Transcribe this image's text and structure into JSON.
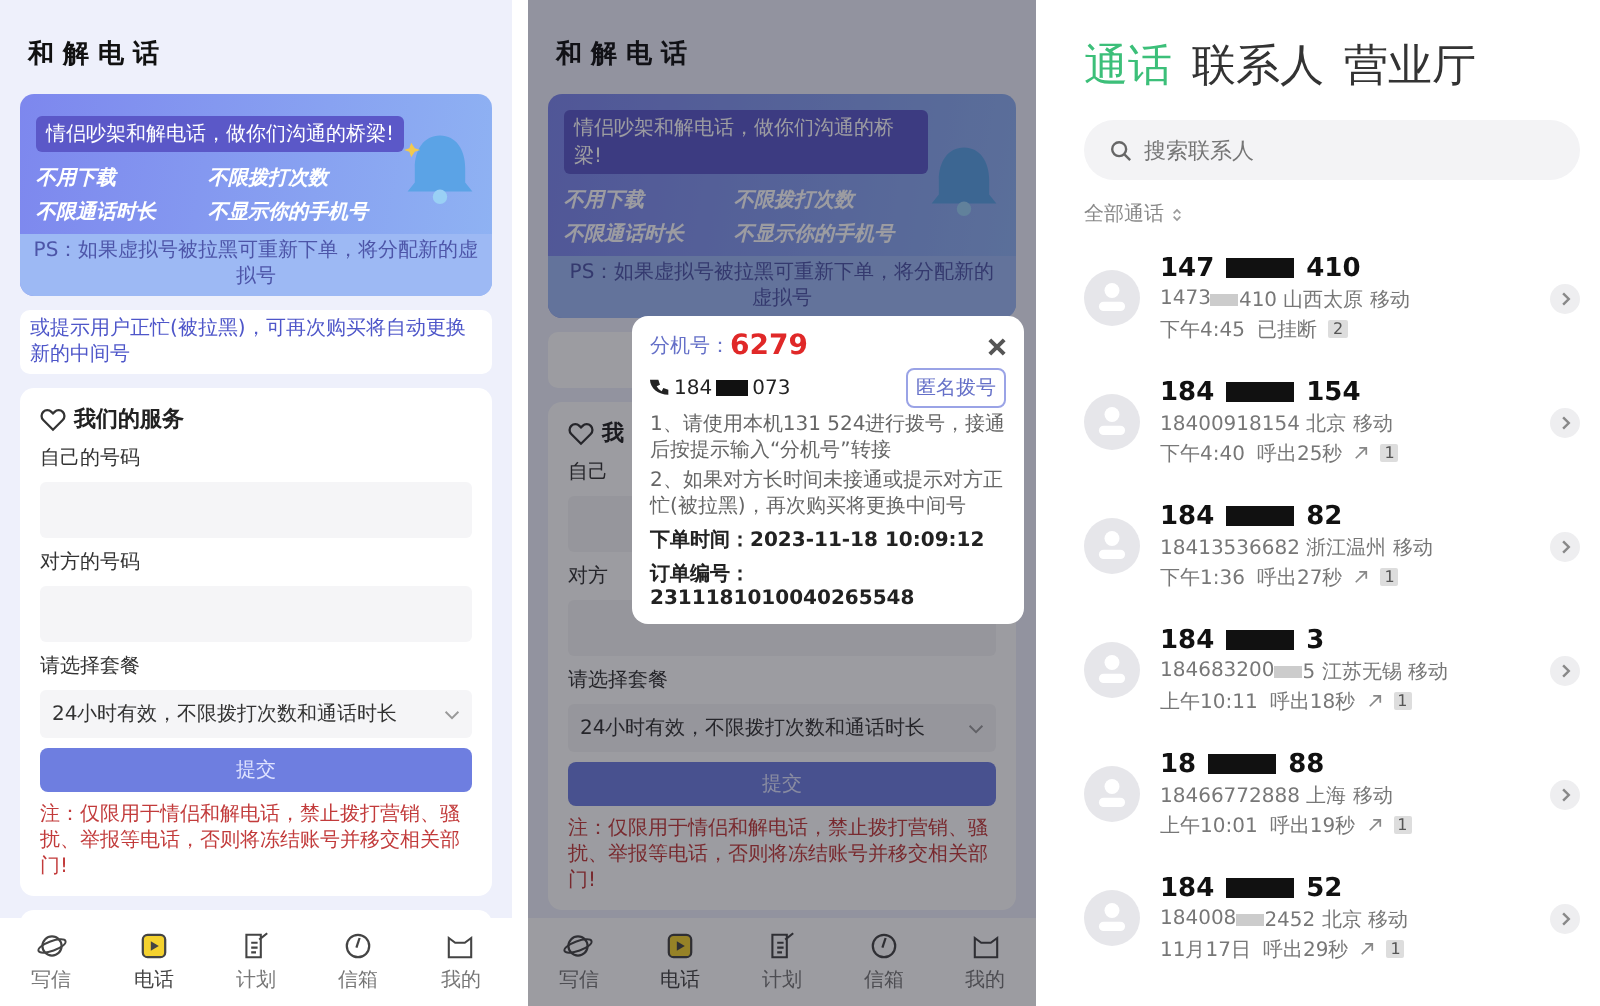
{
  "form_screen": {
    "title": "和 解 电 话",
    "banner": {
      "bubble": "情侣吵架和解电话，做你们沟通的桥梁!",
      "slogans": [
        "不用下载",
        "不限拨打次数",
        "不限通话时长",
        "不显示你的手机号"
      ],
      "ps": "PS：如果虚拟号被拉黑可重新下单，将分配新的虚拟号"
    },
    "notice": "或提示用户正忙(被拉黑)，可再次购买将自动更换新的中间号",
    "service": {
      "heading": "我们的服务",
      "fields": [
        {
          "label": "自己的号码"
        },
        {
          "label": "对方的号码"
        }
      ],
      "plan_label": "请选择套餐",
      "plan_value": "24小时有效，不限拨打次数和通话时长",
      "submit": "提交",
      "note": "注：仅限用于情侣和解电话，禁止拨打营销、骚扰、举报等电话，否则将冻结账号并移交相关部门!"
    },
    "tabs": [
      {
        "label": "写信",
        "selected": false
      },
      {
        "label": "电话",
        "selected": true
      },
      {
        "label": "计划",
        "selected": false
      },
      {
        "label": "信箱",
        "selected": false
      },
      {
        "label": "我的",
        "selected": false
      }
    ]
  },
  "dialog_screen": {
    "backdrop": {
      "title": "和 解 电 话",
      "banner": {
        "bubble": "情侣吵架和解电话，做你们沟通的桥梁!",
        "slogans": [
          "不用下载",
          "不限拨打次数",
          "不限通话时长",
          "不显示你的手机号"
        ],
        "ps": "PS：如果虚拟号被拉黑可重新下单，将分配新的虚拟号"
      },
      "heading_fragment": "我",
      "field_label_fragments": [
        "自己",
        "对方"
      ],
      "plan_label": "请选择套餐",
      "plan_value": "24小时有效，不限拨打次数和通话时长",
      "submit": "提交",
      "note": "注：仅限用于情侣和解电话，禁止拨打营销、骚扰、举报等电话，否则将冻结账号并移交相关部门!",
      "tabs": [
        {
          "label": "写信",
          "selected": false
        },
        {
          "label": "电话",
          "selected": true
        },
        {
          "label": "计划",
          "selected": false
        },
        {
          "label": "信箱",
          "selected": false
        },
        {
          "label": "我的",
          "selected": false
        }
      ]
    },
    "dialog": {
      "ext_label": "分机号：",
      "ext": "6279",
      "phone_prefix": "184",
      "phone_suffix": "073",
      "anonymous_button": "匿名拨号",
      "steps": [
        "1、请使用本机131 524进行拨号，接通后按提示输入“分机号”转接",
        "2、如果对方长时间未接通或提示对方正忙(被拉黑)，再次购买将更换中间号"
      ],
      "order_time": "下单时间：2023-11-18 10:09:12",
      "order_no": "订单编号：2311181010040265548"
    }
  },
  "calls_screen": {
    "tabs": [
      {
        "label": "通话",
        "selected": true
      },
      {
        "label": "联系人",
        "selected": false
      },
      {
        "label": "营业厅",
        "selected": false
      }
    ],
    "search": {
      "placeholder": "搜索联系人"
    },
    "filter": "全部通话",
    "calls": [
      {
        "number_prefix": "147",
        "number_suffix": "410",
        "detail_parts": [
          "1473",
          "410 山西太原 移动"
        ],
        "time": "下午4:45",
        "status": "已挂断",
        "outgoing": false,
        "count": "2"
      },
      {
        "number_prefix": "184",
        "number_suffix": "154",
        "detail_parts": [
          "18400918154 北京 移动"
        ],
        "time": "下午4:40",
        "status": "呼出25秒",
        "outgoing": true,
        "count": "1"
      },
      {
        "number_prefix": "184",
        "number_suffix": "82",
        "detail_parts": [
          "18413536682 浙江温州 移动"
        ],
        "time": "下午1:36",
        "status": "呼出27秒",
        "outgoing": true,
        "count": "1"
      },
      {
        "number_prefix": "184",
        "number_suffix": "3",
        "detail_parts": [
          "184683200",
          "5 江苏无锡 移动"
        ],
        "time": "上午10:11",
        "status": "呼出18秒",
        "outgoing": true,
        "count": "1"
      },
      {
        "number_prefix": "18",
        "number_suffix": "88",
        "detail_parts": [
          "18466772888 上海 移动"
        ],
        "time": "上午10:01",
        "status": "呼出19秒",
        "outgoing": true,
        "count": "1"
      },
      {
        "number_prefix": "184",
        "number_suffix": "52",
        "detail_parts": [
          "184008",
          "2452 北京 移动"
        ],
        "time": "11月17日",
        "status": "呼出29秒",
        "outgoing": true,
        "count": "1"
      }
    ]
  }
}
